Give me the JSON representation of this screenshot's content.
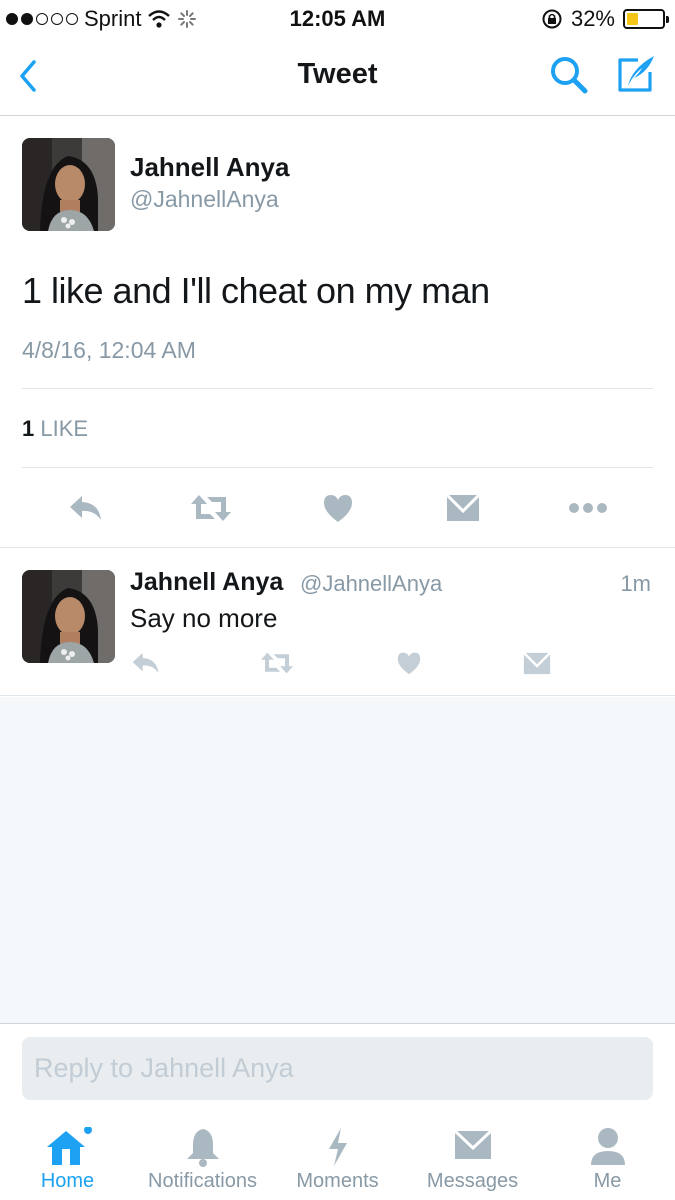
{
  "status_bar": {
    "carrier": "Sprint",
    "time": "12:05 AM",
    "battery_percent": "32%",
    "battery_level": 0.32,
    "signal_bars_filled": 2,
    "signal_bars_total": 5
  },
  "nav": {
    "title": "Tweet",
    "back_icon": "chevron-left-icon",
    "search_icon": "search-icon",
    "compose_icon": "compose-icon"
  },
  "tweet": {
    "name": "Jahnell Anya",
    "handle": "@JahnellAnya",
    "text": "1 like and I'll cheat on my man",
    "timestamp": "4/8/16, 12:04 AM",
    "like_count": "1",
    "like_label": "LIKE"
  },
  "reply": {
    "name": "Jahnell Anya",
    "handle": "@JahnellAnya",
    "time": "1m",
    "text": "Say no more"
  },
  "composer": {
    "placeholder": "Reply to Jahnell Anya",
    "value": ""
  },
  "tabs": [
    {
      "label": "Home",
      "icon": "home-icon",
      "active": true
    },
    {
      "label": "Notifications",
      "icon": "bell-icon",
      "active": false
    },
    {
      "label": "Moments",
      "icon": "lightning-icon",
      "active": false
    },
    {
      "label": "Messages",
      "icon": "envelope-icon",
      "active": false
    },
    {
      "label": "Me",
      "icon": "person-icon",
      "active": false
    }
  ],
  "colors": {
    "accent": "#1da1f2",
    "secondary_text": "#8899a6",
    "icon_gray": "#aab8c2",
    "background": "#f5f8fa"
  }
}
